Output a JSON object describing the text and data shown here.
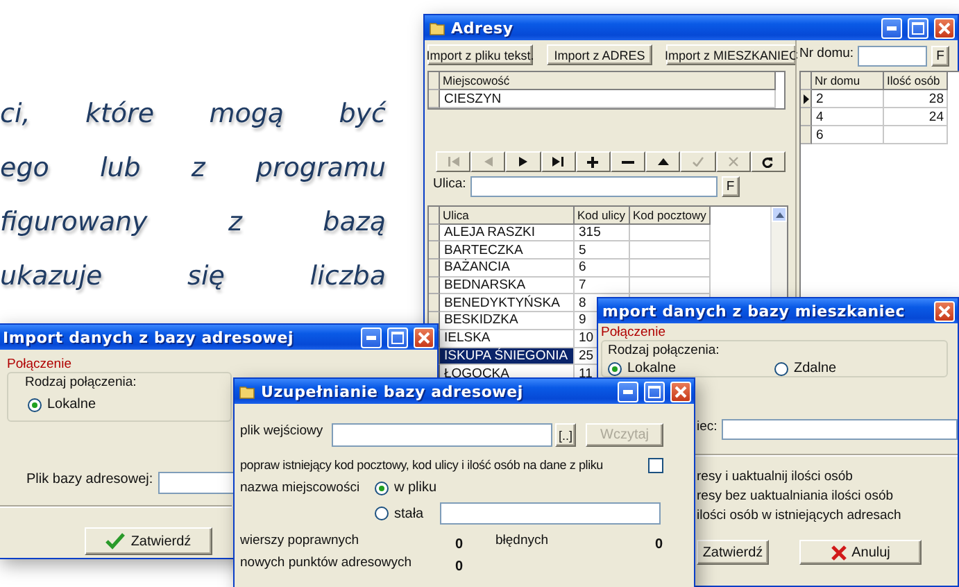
{
  "document": {
    "lines": [
      "ci,  które  mogą  być",
      "ego  lub  z  programu",
      "figurowany  z  bazą",
      "ukazuje  się  liczba"
    ]
  },
  "adresy": {
    "title": "Adresy",
    "import_buttons": [
      "Import z pliku tekst.",
      "Import z ADRES",
      "Import z MIESZKANIEC"
    ],
    "locality_grid": {
      "columns": [
        "Miejscowość"
      ],
      "rows": [
        {
          "cells": [
            "CIESZYN"
          ]
        }
      ]
    },
    "navigator": [
      {
        "kind": "first",
        "disabled": true
      },
      {
        "kind": "prior",
        "disabled": true
      },
      {
        "kind": "next",
        "disabled": false
      },
      {
        "kind": "last",
        "disabled": false
      },
      {
        "kind": "insert",
        "disabled": false
      },
      {
        "kind": "delete",
        "disabled": false
      },
      {
        "kind": "edit",
        "disabled": false
      },
      {
        "kind": "post",
        "disabled": true
      },
      {
        "kind": "cancel",
        "disabled": true
      },
      {
        "kind": "refresh",
        "disabled": false
      }
    ],
    "street_filter": {
      "label": "Ulica:",
      "button": "F"
    },
    "street_grid": {
      "columns": [
        "Ulica",
        "Kod ulicy",
        "Kod pocztowy"
      ],
      "rows": [
        {
          "cells": [
            "ALEJA RASZKI",
            "315"
          ],
          "selected": false
        },
        {
          "cells": [
            "BARTECZKA",
            "5"
          ],
          "selected": false
        },
        {
          "cells": [
            "BAŻANCIA",
            "6"
          ],
          "selected": false
        },
        {
          "cells": [
            "BEDNARSKA",
            "7"
          ],
          "selected": false
        },
        {
          "cells": [
            "BENEDYKTYŃSKA",
            "8"
          ],
          "selected": false
        },
        {
          "cells": [
            "BESKIDZKA",
            "9"
          ],
          "selected": false
        },
        {
          "cells": [
            "IELSKA",
            "10"
          ],
          "selected": false
        },
        {
          "cells": [
            "ISKUPA ŚNIEGONIA",
            "25"
          ],
          "selected": true
        },
        {
          "cells": [
            "ŁOGOCKA",
            "11"
          ],
          "selected": false
        }
      ]
    },
    "house_filter": {
      "label": "Nr domu:",
      "button": "F"
    },
    "house_grid": {
      "columns": [
        "Nr domu",
        "Ilość osób"
      ],
      "rows": [
        {
          "cells": [
            "2",
            "28"
          ],
          "current": true
        },
        {
          "cells": [
            "4",
            "24"
          ],
          "current": false
        },
        {
          "cells": [
            "6"
          ],
          "current": false
        }
      ]
    }
  },
  "mieszkaniec": {
    "title": "mport danych z bazy mieszkaniec",
    "section": "Połączenie",
    "group_label": "Rodzaj połączenia:",
    "connection_options": [
      {
        "label": "Lokalne",
        "selected": true
      },
      {
        "label": "Zdalne",
        "selected": false
      }
    ],
    "file_label": "iec:",
    "options": [
      "resy i uaktualnij ilości osób",
      "resy bez uaktualniania ilości osób",
      "ilości osób w istniejących adresach"
    ],
    "buttons": [
      {
        "label": "Zatwierdź",
        "kind": "plain"
      },
      {
        "label": "Anuluj",
        "kind": "cancel"
      }
    ]
  },
  "adresowej": {
    "title": "Import danych z bazy adresowej",
    "section": "Połączenie",
    "group_label": "Rodzaj połączenia:",
    "connection_options": [
      {
        "label": "Lokalne",
        "selected": true
      }
    ],
    "file_label": "Plik bazy adresowej:",
    "buttons": [
      {
        "label": "Zatwierdź",
        "kind": "confirm"
      }
    ]
  },
  "uzupelnianie": {
    "title": "Uzupełnianie bazy adresowej",
    "input_label": "plik wejściowy",
    "browse_button": "[..]",
    "load_button": {
      "label": "Wczytaj",
      "disabled": true
    },
    "overwrite_option": {
      "label": "popraw istniejący kod pocztowy, kod ulicy i ilość osób na dane z pliku",
      "checked": false
    },
    "locality_label": "nazwa miejscowości",
    "locality_options": [
      {
        "label": "w pliku",
        "selected": true
      },
      {
        "label": "stała",
        "selected": false
      }
    ],
    "stats": [
      {
        "label": "wierszy poprawnych",
        "value": "0"
      },
      {
        "label": "błędnych",
        "value": "0"
      },
      {
        "label": "nowych punktów adresowych",
        "value": "0"
      }
    ]
  }
}
